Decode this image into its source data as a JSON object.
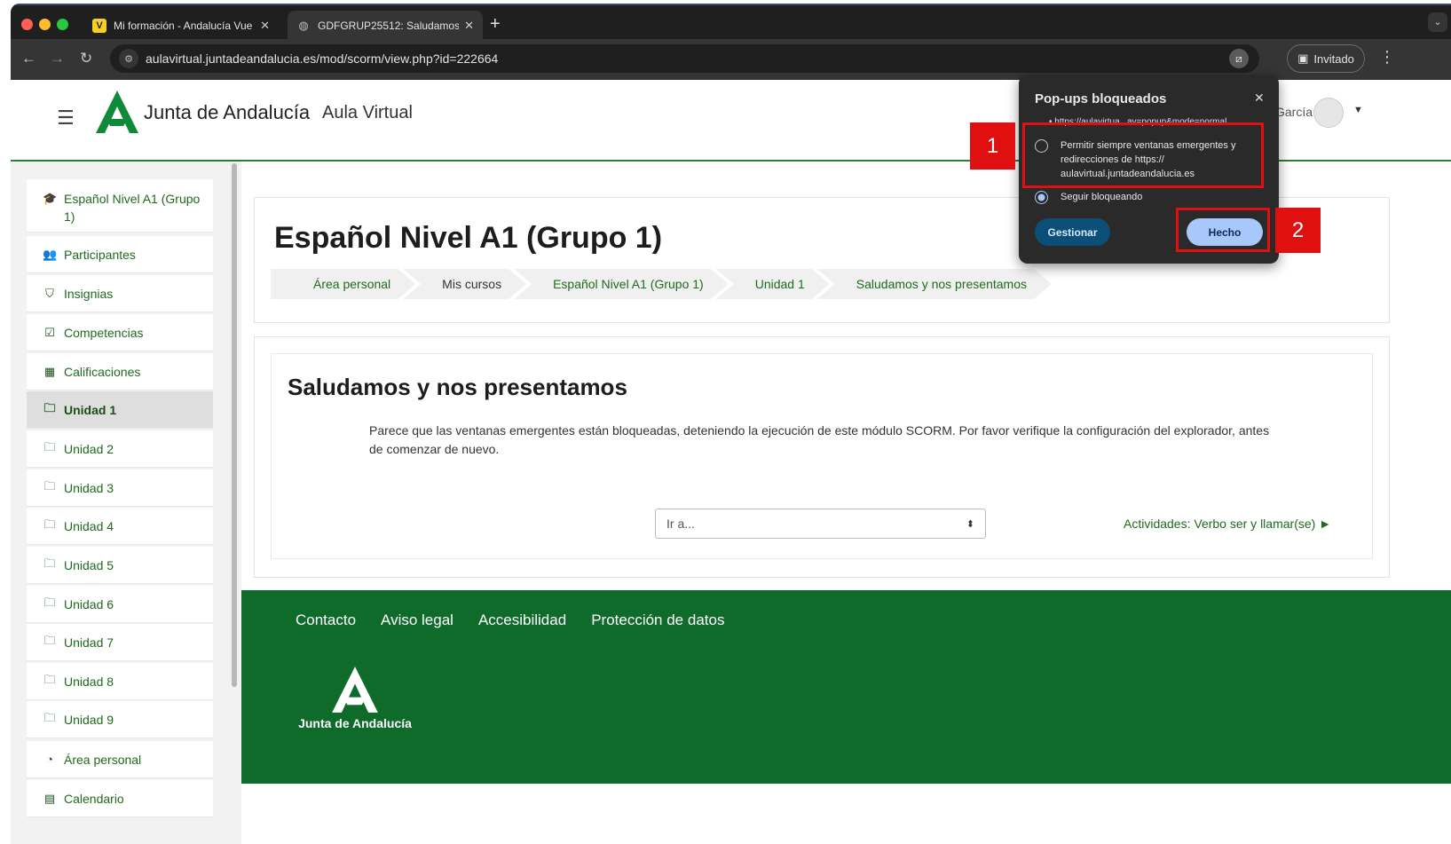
{
  "browser": {
    "tabs": [
      {
        "favicon": "V",
        "title": "Mi formación - Andalucía Vue"
      },
      {
        "favicon": "globe-icon",
        "title": "GDFGRUP25512: Saludamos"
      }
    ],
    "url": "aulavirtual.juntadeandalucia.es/mod/scorm/view.php?id=222664",
    "guest_label": "Invitado",
    "traffic_lights": [
      "#ff5f57",
      "#febc2e",
      "#28c840"
    ]
  },
  "site": {
    "brand": "Junta de Andalucía",
    "subbrand": "Aula Virtual",
    "user_name": "García",
    "brand_color": "#0e6b2a"
  },
  "sidebar": {
    "items": [
      {
        "icon": "graduation-cap-icon",
        "glyph": "🎓",
        "label": "Español Nivel A1 (Grupo 1)"
      },
      {
        "icon": "users-icon",
        "glyph": "👥",
        "label": "Participantes"
      },
      {
        "icon": "shield-icon",
        "glyph": "⛉",
        "label": "Insignias"
      },
      {
        "icon": "check-square-icon",
        "glyph": "☑",
        "label": "Competencias"
      },
      {
        "icon": "table-icon",
        "glyph": "▦",
        "label": "Calificaciones"
      },
      {
        "icon": "folder-icon",
        "glyph": "🗀",
        "label": "Unidad 1"
      },
      {
        "icon": "folder-icon",
        "glyph": "🗀",
        "label": "Unidad 2"
      },
      {
        "icon": "folder-icon",
        "glyph": "🗀",
        "label": "Unidad 3"
      },
      {
        "icon": "folder-icon",
        "glyph": "🗀",
        "label": "Unidad 4"
      },
      {
        "icon": "folder-icon",
        "glyph": "🗀",
        "label": "Unidad 5"
      },
      {
        "icon": "folder-icon",
        "glyph": "🗀",
        "label": "Unidad 6"
      },
      {
        "icon": "folder-icon",
        "glyph": "🗀",
        "label": "Unidad 7"
      },
      {
        "icon": "folder-icon",
        "glyph": "🗀",
        "label": "Unidad 8"
      },
      {
        "icon": "folder-icon",
        "glyph": "🗀",
        "label": "Unidad 9"
      },
      {
        "icon": "dashboard-icon",
        "glyph": "◔",
        "label": "Área personal"
      },
      {
        "icon": "calendar-icon",
        "glyph": "▤",
        "label": "Calendario"
      }
    ]
  },
  "course": {
    "title": "Español Nivel A1 (Grupo 1)",
    "breadcrumbs": [
      "Área personal",
      "Mis cursos",
      "Español Nivel A1 (Grupo 1)",
      "Unidad 1",
      "Saludamos y nos presentamos"
    ]
  },
  "activity": {
    "title": "Saludamos y nos presentamos",
    "message": "Parece que las ventanas emergentes están bloqueadas, deteniendo la ejecución de este módulo SCORM. Por favor verifique la configuración del explorador, antes de comenzar de nuevo.",
    "jump_placeholder": "Ir a...",
    "next_activity": "Actividades: Verbo ser y llamar(se) ►"
  },
  "footer": {
    "links": [
      "Contacto",
      "Aviso legal",
      "Accesibilidad",
      "Protección de datos"
    ],
    "logo_text": "Junta de Andalucía"
  },
  "popup": {
    "title": "Pop-ups bloqueados",
    "blocked_url": "• https://aulavirtua...av=popup&mode=normal",
    "option_allow": "Permitir siempre ventanas emergentes y redirecciones de https:// aulavirtual.juntadeandalucia.es",
    "option_block": "Seguir bloqueando",
    "selected": "block",
    "manage_label": "Gestionar",
    "done_label": "Hecho"
  },
  "annotations": {
    "marker_1": "1",
    "marker_2": "2",
    "color": "#e01010"
  }
}
